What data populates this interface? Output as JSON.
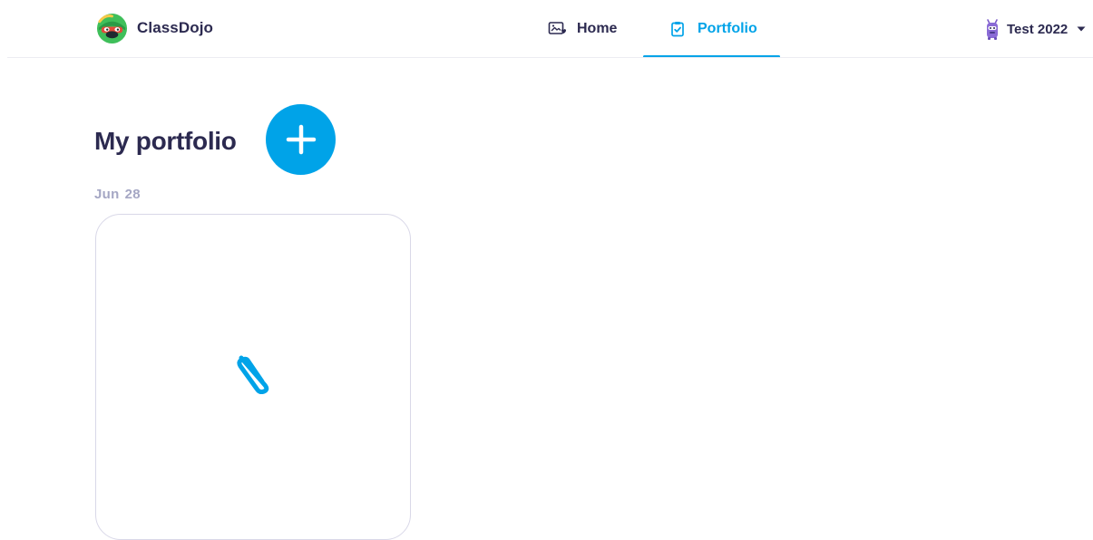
{
  "app": {
    "brand_name": "ClassDojo",
    "brand_logo": "classdojo-monster-logo"
  },
  "nav": {
    "tabs": [
      {
        "label": "Home",
        "icon": "photo-heart-icon",
        "active": false
      },
      {
        "label": "Portfolio",
        "icon": "clipboard-check-icon",
        "active": true
      }
    ]
  },
  "user": {
    "name": "Test 2022",
    "avatar": "purple-monster-avatar",
    "dropdown_icon": "caret-down-icon"
  },
  "main": {
    "title": "My portfolio",
    "add_button_icon": "plus-icon",
    "entries": [
      {
        "date_month": "Jun",
        "date_day": "28",
        "attachment_icon": "paperclip-icon"
      }
    ]
  },
  "colors": {
    "accent": "#00a3e8",
    "text_primary": "#2c2a50",
    "date_text": "#a5a7c4",
    "card_border": "#d9d8e8"
  }
}
